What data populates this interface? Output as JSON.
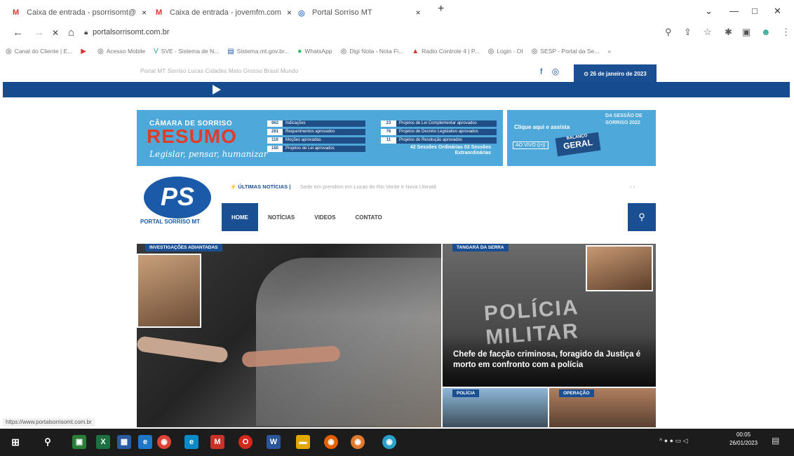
{
  "browser": {
    "tabs": [
      {
        "icon": "M",
        "label": "Caixa de entrada - psorrisomt@",
        "close": "×"
      },
      {
        "icon": "M",
        "label": "Caixa de entrada - jovemfm.com",
        "close": "×"
      },
      {
        "icon": "◎",
        "label": "Portal Sorriso MT",
        "close": "×"
      }
    ],
    "new_tab": "+",
    "window_controls": {
      "dropdown": "⌄",
      "minimize": "—",
      "maximize": "□",
      "close": "✕"
    },
    "nav": {
      "back": "←",
      "forward": "→",
      "stop": "✕",
      "home": "⌂"
    },
    "url": "portalsorrisomt.com.br",
    "bookmarks": [
      {
        "icon": "◎",
        "label": "Canal do Cliente | E..."
      },
      {
        "icon": "▶",
        "label": ""
      },
      {
        "icon": "◎",
        "label": "Acesso Mobile"
      },
      {
        "icon": "V",
        "label": "SVE - Sistema de N..."
      },
      {
        "icon": "▤",
        "label": "Sistema.mt.gov.br..."
      },
      {
        "icon": "●",
        "label": "WhatsApp"
      },
      {
        "icon": "◎",
        "label": "Digi Nota - Nota Fi..."
      },
      {
        "icon": "▲",
        "label": "Radio Controle 4 | P..."
      },
      {
        "icon": "◎",
        "label": "Login - OI"
      },
      {
        "icon": "◎",
        "label": "SESP - Portal da Se..."
      }
    ],
    "bookmarks_more": "»",
    "status_url": "https://www.portalsorrisomt.com.br"
  },
  "site": {
    "top_menu": "Portal MT     Sorriso   Lucas   Cidades   Mato Grosso   Brasil   Mundo",
    "social": {
      "facebook": "f",
      "instagram": "◎"
    },
    "date": "⊙ 26 de janeiro de 2023",
    "banner_left": {
      "line1": "CÂMARA DE SORRISO",
      "line2": "RESUMO",
      "line3": "Legislar, pensar, humanizar",
      "rows": [
        {
          "n": "962",
          "t": "Indicações"
        },
        {
          "n": "281",
          "t": "Requerimentos aprovados"
        },
        {
          "n": "116",
          "t": "Moções aprovadas"
        },
        {
          "n": "180",
          "t": "Projetos de Lei aprovados"
        }
      ],
      "rows2": [
        {
          "n": "23",
          "t": "Projetos de Lei Complementar aprovados"
        },
        {
          "n": "76",
          "t": "Projetos de Decreto Legislativo aprovados"
        },
        {
          "n": "11",
          "t": "Projetos de Resolução aprovados"
        }
      ],
      "footer": "42 Sessões Ordinárias 03 Sessões Extraordinárias"
    },
    "banner_right": {
      "cta": "Clique aqui e assista",
      "live": "AO VIVO ((•))",
      "badge_small": "BALANÇO",
      "badge_big": "GERAL",
      "side": "DA SESSÃO DE SORRISO 2022"
    },
    "logo": {
      "mark": "PS",
      "name": "PORTAL SORRISO MT"
    },
    "ticker": {
      "label": "⚡ ÚLTIMAS NOTÍCIAS |",
      "text": "Sede em prendem em Lucas do Rio Verde e Nova Ubiratã",
      "arrows": "‹   ›"
    },
    "nav": [
      {
        "label": "HOME",
        "active": true
      },
      {
        "label": "NOTÍCIAS",
        "active": false
      },
      {
        "label": "VIDEOS",
        "active": false
      },
      {
        "label": "CONTATO",
        "active": false
      }
    ],
    "search_icon": "⚲",
    "hero": {
      "category": "INVESTIGAÇÕES ADIANTADAS"
    },
    "side_main": {
      "category": "TANGARÁ DA SERRA",
      "watermark": "POLÍCIA MILITAR",
      "title": "Chefe de facção criminosa, foragido da Justiça é morto em confronto com a polícia"
    },
    "side_small_1": {
      "category": "POLÍCIA"
    },
    "side_small_2": {
      "category": "OPERAÇÃO"
    }
  },
  "taskbar": {
    "start": "⊞",
    "search": "⚲",
    "apps": [
      "▣",
      "X",
      "▦",
      "e",
      "◉",
      "e",
      "M",
      "O",
      "W",
      "▬",
      "◉",
      "◉",
      "◉"
    ],
    "tray": "^ ● ● ▭ ◁",
    "time": "00:05",
    "date": "26/01/2023",
    "notifications": "▤"
  },
  "colors": {
    "brand_blue": "#1b4f93",
    "banner_blue": "#4ea8d9",
    "resumo_red": "#e23b2a",
    "taskbar": "#1c1c1c"
  }
}
